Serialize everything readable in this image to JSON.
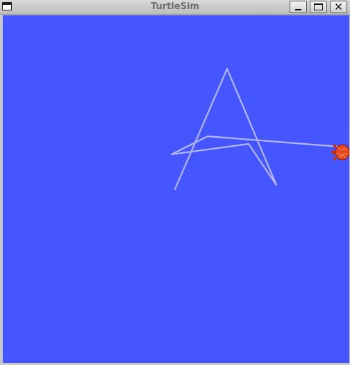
{
  "window": {
    "title": "TurtleSim",
    "buttons": {
      "menu_icon": "window-menu-icon",
      "minimize_icon": "minimize-icon",
      "maximize_icon": "maximize-icon",
      "close_glyph": "✕"
    }
  },
  "canvas": {
    "background_color": "#4556ff",
    "pen_color": "#b3b8ff",
    "turtle_color": "#e8461c"
  }
}
